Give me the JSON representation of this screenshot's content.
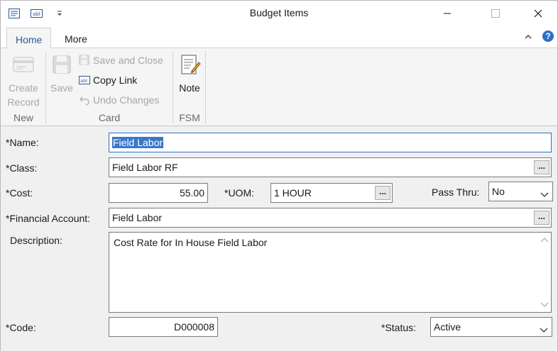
{
  "window": {
    "title": "Budget Items"
  },
  "quick_access": {
    "icons": [
      "list-view-icon",
      "text-field-icon",
      "customize-dropdown-icon"
    ]
  },
  "tabs": [
    {
      "label": "Home",
      "active": true
    },
    {
      "label": "More",
      "active": false
    }
  ],
  "ribbon": {
    "new_group": {
      "label": "New",
      "create_record": "Create\nRecord",
      "create_record_line1": "Create",
      "create_record_line2": "Record"
    },
    "card_group": {
      "label": "Card",
      "save": "Save",
      "save_and_close": "Save and Close",
      "copy_link": "Copy Link",
      "undo_changes": "Undo Changes"
    },
    "fsm_group": {
      "label": "FSM",
      "note": "Note"
    }
  },
  "form": {
    "name": {
      "label": "*Name:",
      "value": "Field Labor"
    },
    "class": {
      "label": "*Class:",
      "value": "Field Labor RF"
    },
    "cost": {
      "label": "*Cost:",
      "value": "55.00"
    },
    "uom": {
      "label": "*UOM:",
      "value": "1 HOUR"
    },
    "pass_thru": {
      "label": "Pass Thru:",
      "value": "No"
    },
    "financial_account": {
      "label": "*Financial Account:",
      "value": "Field Labor"
    },
    "description": {
      "label": "Description:",
      "value": "Cost Rate for In House Field Labor"
    },
    "code": {
      "label": "*Code:",
      "value": "D000008"
    },
    "status": {
      "label": "*Status:",
      "value": "Active"
    },
    "ellipsis": "..."
  },
  "colors": {
    "accent": "#2b579a",
    "selection": "#3a78c8",
    "help": "#2b6fc7"
  }
}
